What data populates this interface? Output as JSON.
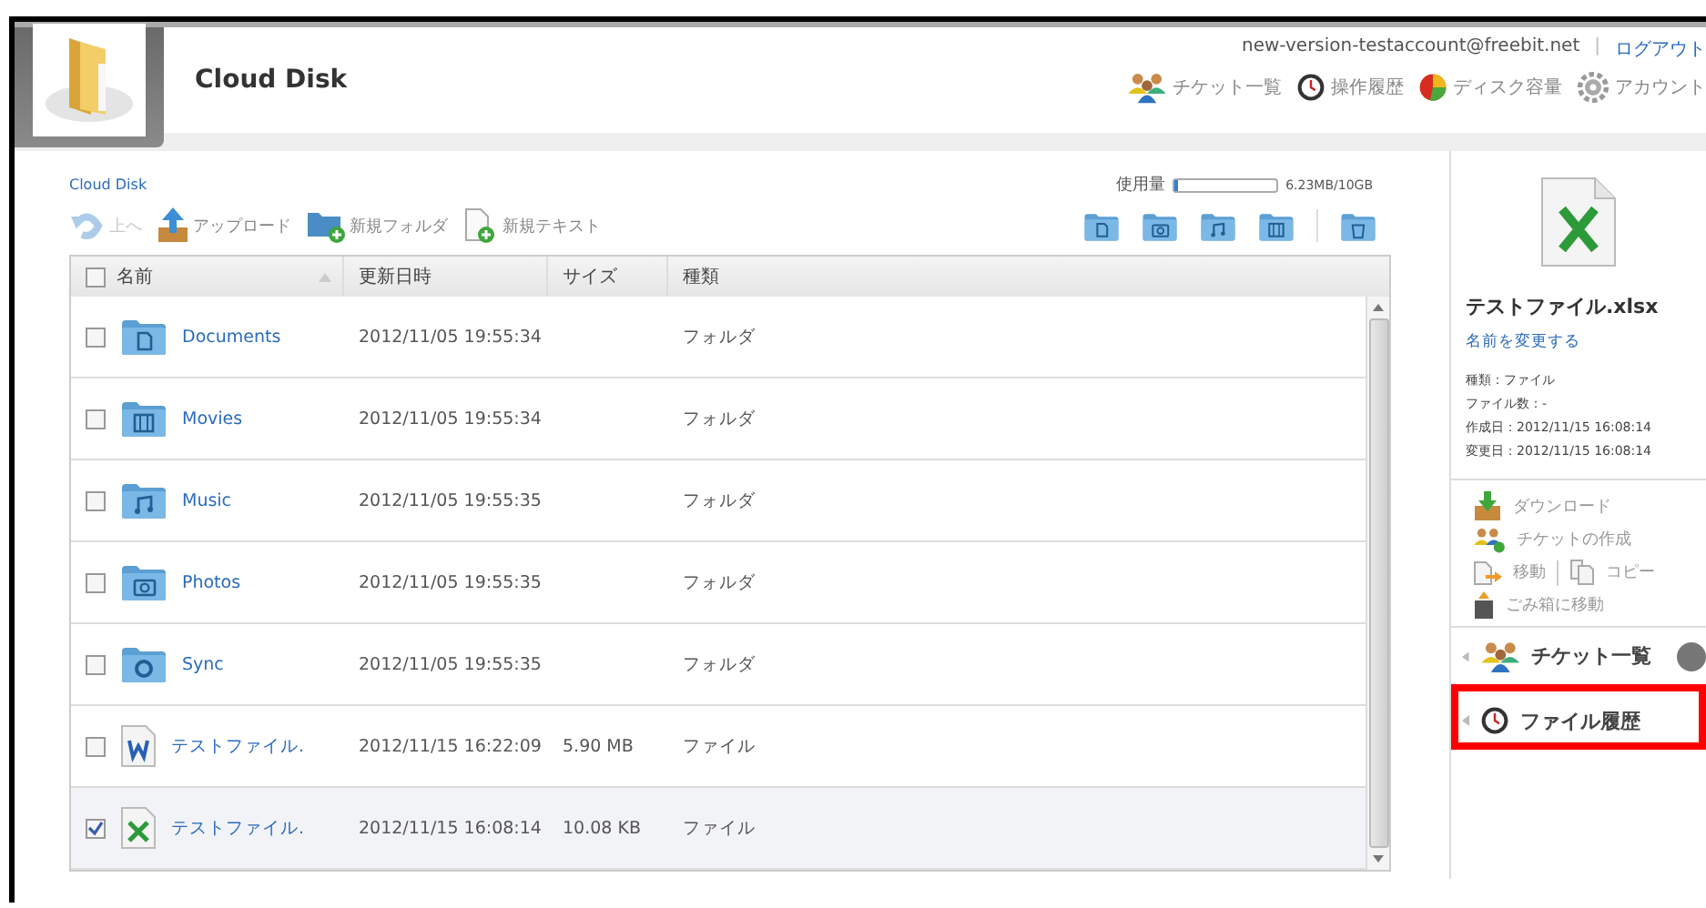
{
  "header": {
    "app_title": "Cloud Disk",
    "account_email": "new-version-testaccount@freebit.net",
    "separator": "|",
    "logout": "ログアウト",
    "nav": [
      {
        "label": "チケット一覧"
      },
      {
        "label": "操作履歴"
      },
      {
        "label": "ディスク容量"
      },
      {
        "label": "アカウント"
      }
    ]
  },
  "toolbar": {
    "breadcrumb": "Cloud Disk",
    "actions": [
      {
        "label": "上へ",
        "disabled": true
      },
      {
        "label": "アップロード",
        "disabled": false
      },
      {
        "label": "新規フォルダ",
        "disabled": false
      },
      {
        "label": "新規テキスト",
        "disabled": false
      }
    ],
    "usage": {
      "label": "使用量",
      "level": 0.03,
      "reading": "6.23MB/10GB"
    }
  },
  "table": {
    "header_checked": false,
    "columns": [
      "名前",
      "更新日時",
      "サイズ",
      "種類"
    ],
    "rows": [
      {
        "kind": "documents",
        "name": "Documents",
        "modified": "2012/11/05 19:55:34",
        "type": "フォルダ",
        "checked": false,
        "selected": false
      },
      {
        "kind": "movies",
        "name": "Movies",
        "modified": "2012/11/05 19:55:34",
        "type": "フォルダ",
        "checked": false,
        "selected": false
      },
      {
        "kind": "music",
        "name": "Music",
        "modified": "2012/11/05 19:55:35",
        "type": "フォルダ",
        "checked": false,
        "selected": false
      },
      {
        "kind": "photos",
        "name": "Photos",
        "modified": "2012/11/05 19:55:35",
        "type": "フォルダ",
        "checked": false,
        "selected": false
      },
      {
        "kind": "sync",
        "name": "Sync",
        "modified": "2012/11/05 19:55:35",
        "type": "フォルダ",
        "checked": false,
        "selected": false
      },
      {
        "kind": "word",
        "name": "テストファイル.",
        "modified": "2012/11/15 16:22:09",
        "size": "5.90 MB",
        "type": "ファイル",
        "checked": false,
        "selected": false
      },
      {
        "kind": "excel",
        "name": "テストファイル.",
        "modified": "2012/11/15 16:08:14",
        "size": "10.08 KB",
        "type": "ファイル",
        "checked": true,
        "selected": true
      }
    ]
  },
  "details": {
    "file_name": "テストファイル.xlsx",
    "rename": "名前を変更する",
    "properties": [
      "種類：ファイル",
      "ファイル数：-",
      "作成日：2012/11/15 16:08:14",
      "変更日：2012/11/15 16:08:14"
    ],
    "actions": [
      [
        {
          "kind": "download",
          "label": "ダウンロード"
        }
      ],
      [
        {
          "kind": "ticket",
          "label": "チケットの作成"
        }
      ],
      [
        {
          "kind": "move",
          "label": "移動"
        },
        {
          "kind": "copy",
          "label": "コピー"
        }
      ],
      [
        {
          "kind": "trash",
          "label": "ごみ箱に移動"
        }
      ]
    ]
  },
  "sections": [
    {
      "kind": "tickets",
      "label": "チケット一覧",
      "highlighted": false
    },
    {
      "kind": "history",
      "label": "ファイル履歴",
      "highlighted": true
    }
  ]
}
